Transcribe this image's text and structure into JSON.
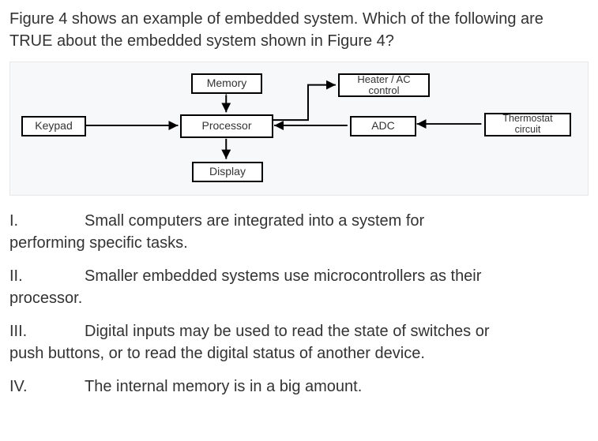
{
  "question": "Figure 4 shows an example of embedded system. Which of the following are TRUE about the embedded system shown in Figure 4?",
  "diagram": {
    "keypad": "Keypad",
    "memory": "Memory",
    "processor": "Processor",
    "display": "Display",
    "heater": "Heater / AC control",
    "adc": "ADC",
    "thermostat": "Thermostat circuit"
  },
  "statements": {
    "s1": {
      "num": "I.",
      "text_a": "Small computers are integrated into a system for",
      "text_b": "performing specific tasks."
    },
    "s2": {
      "num": "II.",
      "text_a": "Smaller embedded systems use microcontrollers as their",
      "text_b": "processor."
    },
    "s3": {
      "num": "III.",
      "text_a": "Digital inputs may be used to read the state of switches or",
      "text_b": "push buttons, or to read the digital status of another device."
    },
    "s4": {
      "num": "IV.",
      "text_a": "The internal memory is in a big amount.",
      "text_b": ""
    }
  }
}
